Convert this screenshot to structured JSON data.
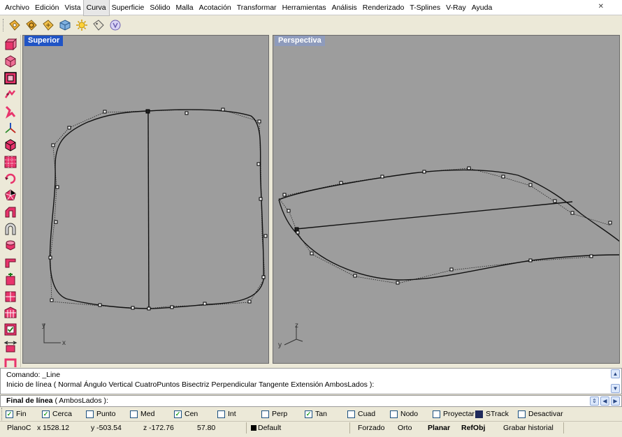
{
  "menu": {
    "items": [
      "Archivo",
      "Edición",
      "Vista",
      "Curva",
      "Superficie",
      "Sólido",
      "Malla",
      "Acotación",
      "Transformar",
      "Herramientas",
      "Análisis",
      "Renderizado",
      "T-Splines",
      "V-Ray",
      "Ayuda"
    ],
    "active": "Curva"
  },
  "toolbar": {
    "icons": [
      "tag-icon",
      "gear-tag-icon",
      "tag-settings-icon",
      "cube-icon",
      "sun-icon",
      "tag-outline-icon",
      "paint-icon"
    ]
  },
  "left_toolbar": {
    "icons": [
      "box-icon",
      "sphere-box-icon",
      "cage-box-icon",
      "pull-icon",
      "bend-icon",
      "axis-icon",
      "cube-select-icon",
      "grid-points-icon",
      "rotate-icon",
      "polygon-icon",
      "arch-icon",
      "arch-u-icon",
      "cylinder-icon",
      "extrude-icon",
      "box-add-icon",
      "box-split-icon",
      "frame-icon",
      "checkbox-icon",
      "merge-icon",
      "shell-icon"
    ]
  },
  "viewports": {
    "top": {
      "title": "Superior",
      "axis_x": "x",
      "axis_y": "y"
    },
    "perspective": {
      "title": "Perspectiva",
      "axis_y": "y",
      "axis_z": "z"
    }
  },
  "command": {
    "history_1": "Comando: _Line",
    "history_2": "Inicio de línea ( Normal  Ángulo  Vertical  CuatroPuntos  Bisectriz  Perpendicular  Tangente  Extensión  AmbosLados ):",
    "prompt_bold": "Final de línea",
    "prompt_rest": " ( AmbosLados ):"
  },
  "osnaps": [
    {
      "label": "Fin",
      "checked": true
    },
    {
      "label": "Cerca",
      "checked": true
    },
    {
      "label": "Punto",
      "checked": false
    },
    {
      "label": "Med",
      "checked": false
    },
    {
      "label": "Cen",
      "checked": true
    },
    {
      "label": "Int",
      "checked": false
    },
    {
      "label": "Perp",
      "checked": false
    },
    {
      "label": "Tan",
      "checked": true
    },
    {
      "label": "Cuad",
      "checked": false
    },
    {
      "label": "Nodo",
      "checked": false
    },
    {
      "label": "Proyectar",
      "checked": false
    },
    {
      "label": "STrack",
      "checked": true,
      "dark": true
    },
    {
      "label": "Desactivar",
      "checked": false
    }
  ],
  "status": {
    "plane": "PlanoC",
    "x": "x 1528.12",
    "y": "y -503.54",
    "z": "z -172.76",
    "distance": "57.80",
    "layer": "Default",
    "layer_color": "#000000",
    "forzado": "Forzado",
    "orto": "Orto",
    "planar": "Planar",
    "refobj": "RefObj",
    "historial": "Grabar historial"
  },
  "colors": {
    "viewport_bg": "#9d9d9d",
    "active_title": "#2054c5",
    "inactive_title": "#8e9bbc"
  }
}
